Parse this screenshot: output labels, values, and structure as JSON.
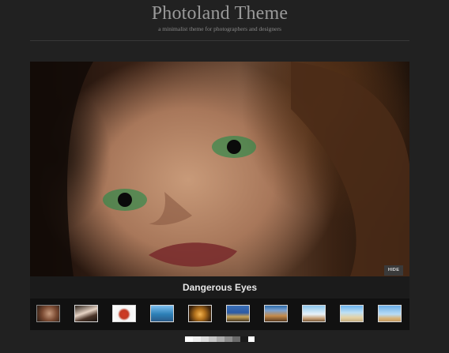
{
  "header": {
    "title": "Photoland Theme",
    "tagline": "a minimalist theme for photographers and designers"
  },
  "slideshow": {
    "caption": "Dangerous Eyes",
    "hide_label": "HIDE",
    "thumbnails": [
      {
        "name": "thumb-portrait"
      },
      {
        "name": "thumb-hands"
      },
      {
        "name": "thumb-fruit"
      },
      {
        "name": "thumb-coast"
      },
      {
        "name": "thumb-cave"
      },
      {
        "name": "thumb-harbor"
      },
      {
        "name": "thumb-valley"
      },
      {
        "name": "thumb-snowy-hills"
      },
      {
        "name": "thumb-beach"
      },
      {
        "name": "thumb-pyramids"
      }
    ]
  }
}
